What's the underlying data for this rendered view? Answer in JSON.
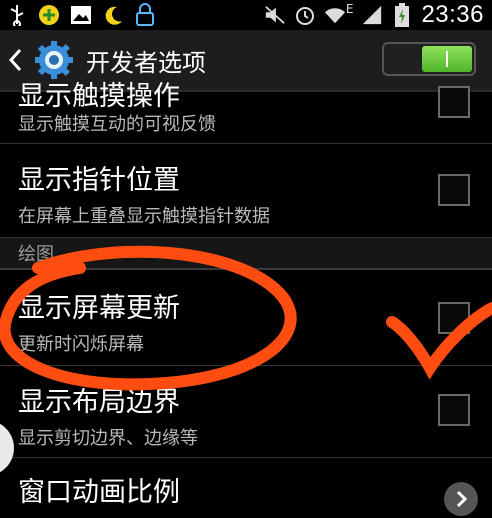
{
  "status_bar": {
    "time": "23:36",
    "network_label": "E",
    "icons": [
      "usb-icon",
      "plus-icon",
      "image-icon",
      "moon-icon",
      "lock-icon",
      "mute-icon",
      "alarm-icon",
      "wifi-icon",
      "signal-icon",
      "battery-charging-icon"
    ]
  },
  "action_bar": {
    "title": "开发者选项",
    "toggle_on": true
  },
  "list": {
    "rows": [
      {
        "title": "显示触摸操作",
        "subtitle": "显示触摸互动的可视反馈",
        "checked": false
      },
      {
        "title": "显示指针位置",
        "subtitle": "在屏幕上重叠显示触摸指针数据",
        "checked": false
      },
      {
        "title": "显示屏幕更新",
        "subtitle": "更新时闪烁屏幕",
        "checked": false
      },
      {
        "title": "显示布局边界",
        "subtitle": "显示剪切边界、边缘等",
        "checked": false
      },
      {
        "title": "窗口动画比例"
      }
    ],
    "section_label": "绘图"
  },
  "colors": {
    "toggle_green": "#6ccf3d",
    "annotation_orange": "#ff4d12"
  }
}
